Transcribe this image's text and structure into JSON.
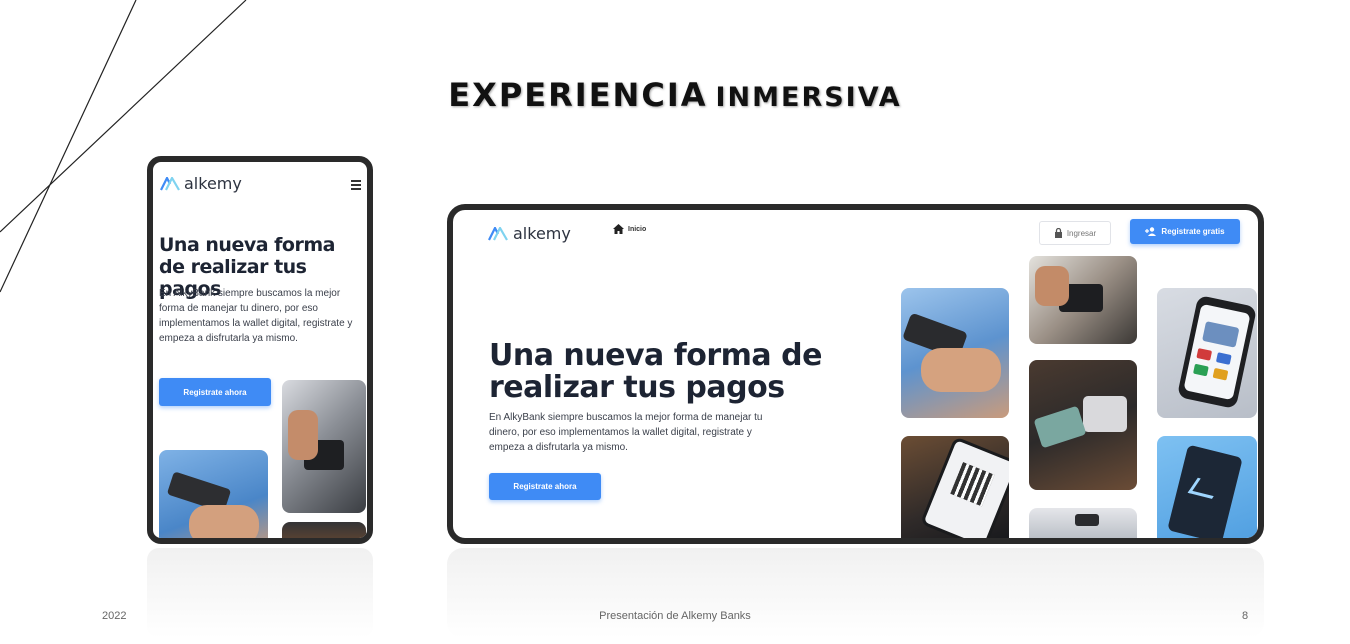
{
  "slide": {
    "title_bold": "EXPERIENCIA",
    "title_rest": "INMERSIVA",
    "footer_year": "2022",
    "footer_center": "Presentación de Alkemy Banks",
    "page_number": "8"
  },
  "brand": {
    "name": "alkemy",
    "accent": "#3f8bf5"
  },
  "mobile": {
    "menu_icon": "hamburger-icon",
    "hero_title": "Una nueva forma de realizar tus pagos",
    "hero_text": "En AlkyBank siempre buscamos la mejor forma de manejar tu dinero, por eso implementamos la wallet digital, registrate y empeza a disfrutarla ya mismo.",
    "cta_label": "Registrate ahora"
  },
  "desktop": {
    "nav_home_label": "Inicio",
    "nav_home_icon": "home-icon",
    "login_label": "Ingresar",
    "login_icon": "lock-icon",
    "signup_label": "Registrate gratis",
    "signup_icon": "add-user-icon",
    "hero_title": "Una nueva forma de realizar tus pagos",
    "hero_text": "En AlkyBank siempre buscamos la mejor forma de manejar tu dinero, por eso implementamos la wallet digital, registrate y empeza a disfrutarla ya mismo.",
    "cta_label": "Registrate ahora"
  }
}
